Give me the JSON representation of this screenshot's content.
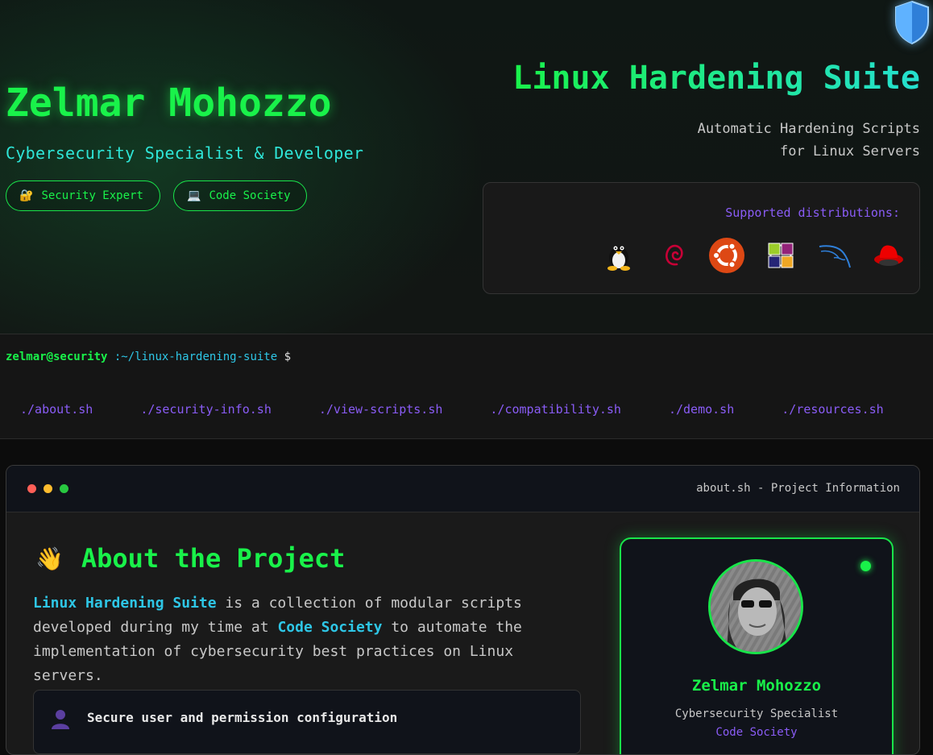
{
  "header": {
    "name": "Zelmar Mohozzo",
    "subtitle": "Cybersecurity Specialist & Developer",
    "badges": [
      {
        "icon": "lock-icon",
        "emoji": "🔐",
        "label": "Security Expert"
      },
      {
        "icon": "laptop-icon",
        "emoji": "💻",
        "label": "Code Society"
      }
    ],
    "logo_icon": "shield-icon",
    "project_title": "Linux Hardening Suite",
    "project_desc_line1": "Automatic Hardening Scripts",
    "project_desc_line2": "for Linux Servers",
    "distros_label": "Supported distributions:",
    "distros": [
      "tux-linux-icon",
      "debian-icon",
      "ubuntu-icon",
      "centos-icon",
      "kali-icon",
      "redhat-icon"
    ]
  },
  "terminal": {
    "user": "zelmar@security",
    "path": ":~/linux-hardening-suite",
    "symbol": "$",
    "commands": [
      "./about.sh",
      "./security-info.sh",
      "./view-scripts.sh",
      "./compatibility.sh",
      "./demo.sh",
      "./resources.sh"
    ]
  },
  "window": {
    "title": "about.sh - Project Information",
    "heading_emoji": "👋",
    "heading": "About the Project",
    "about_hl1": "Linux Hardening Suite",
    "about_t1": " is a collection of modular scripts developed during my time at ",
    "about_hl2": "Code Society",
    "about_t2": " to automate the implementation of cybersecurity best practices on Linux servers.",
    "feature_icon": "user-icon",
    "feature_1": "Secure user and permission configuration"
  },
  "profile": {
    "name": "Zelmar Mohozzo",
    "role": "Cybersecurity Specialist",
    "org": "Code Society"
  },
  "colors": {
    "accent_green": "#19f24a",
    "accent_cyan": "#2ec6e6",
    "accent_purple": "#8a5cf6",
    "background": "#0c0c0c"
  }
}
